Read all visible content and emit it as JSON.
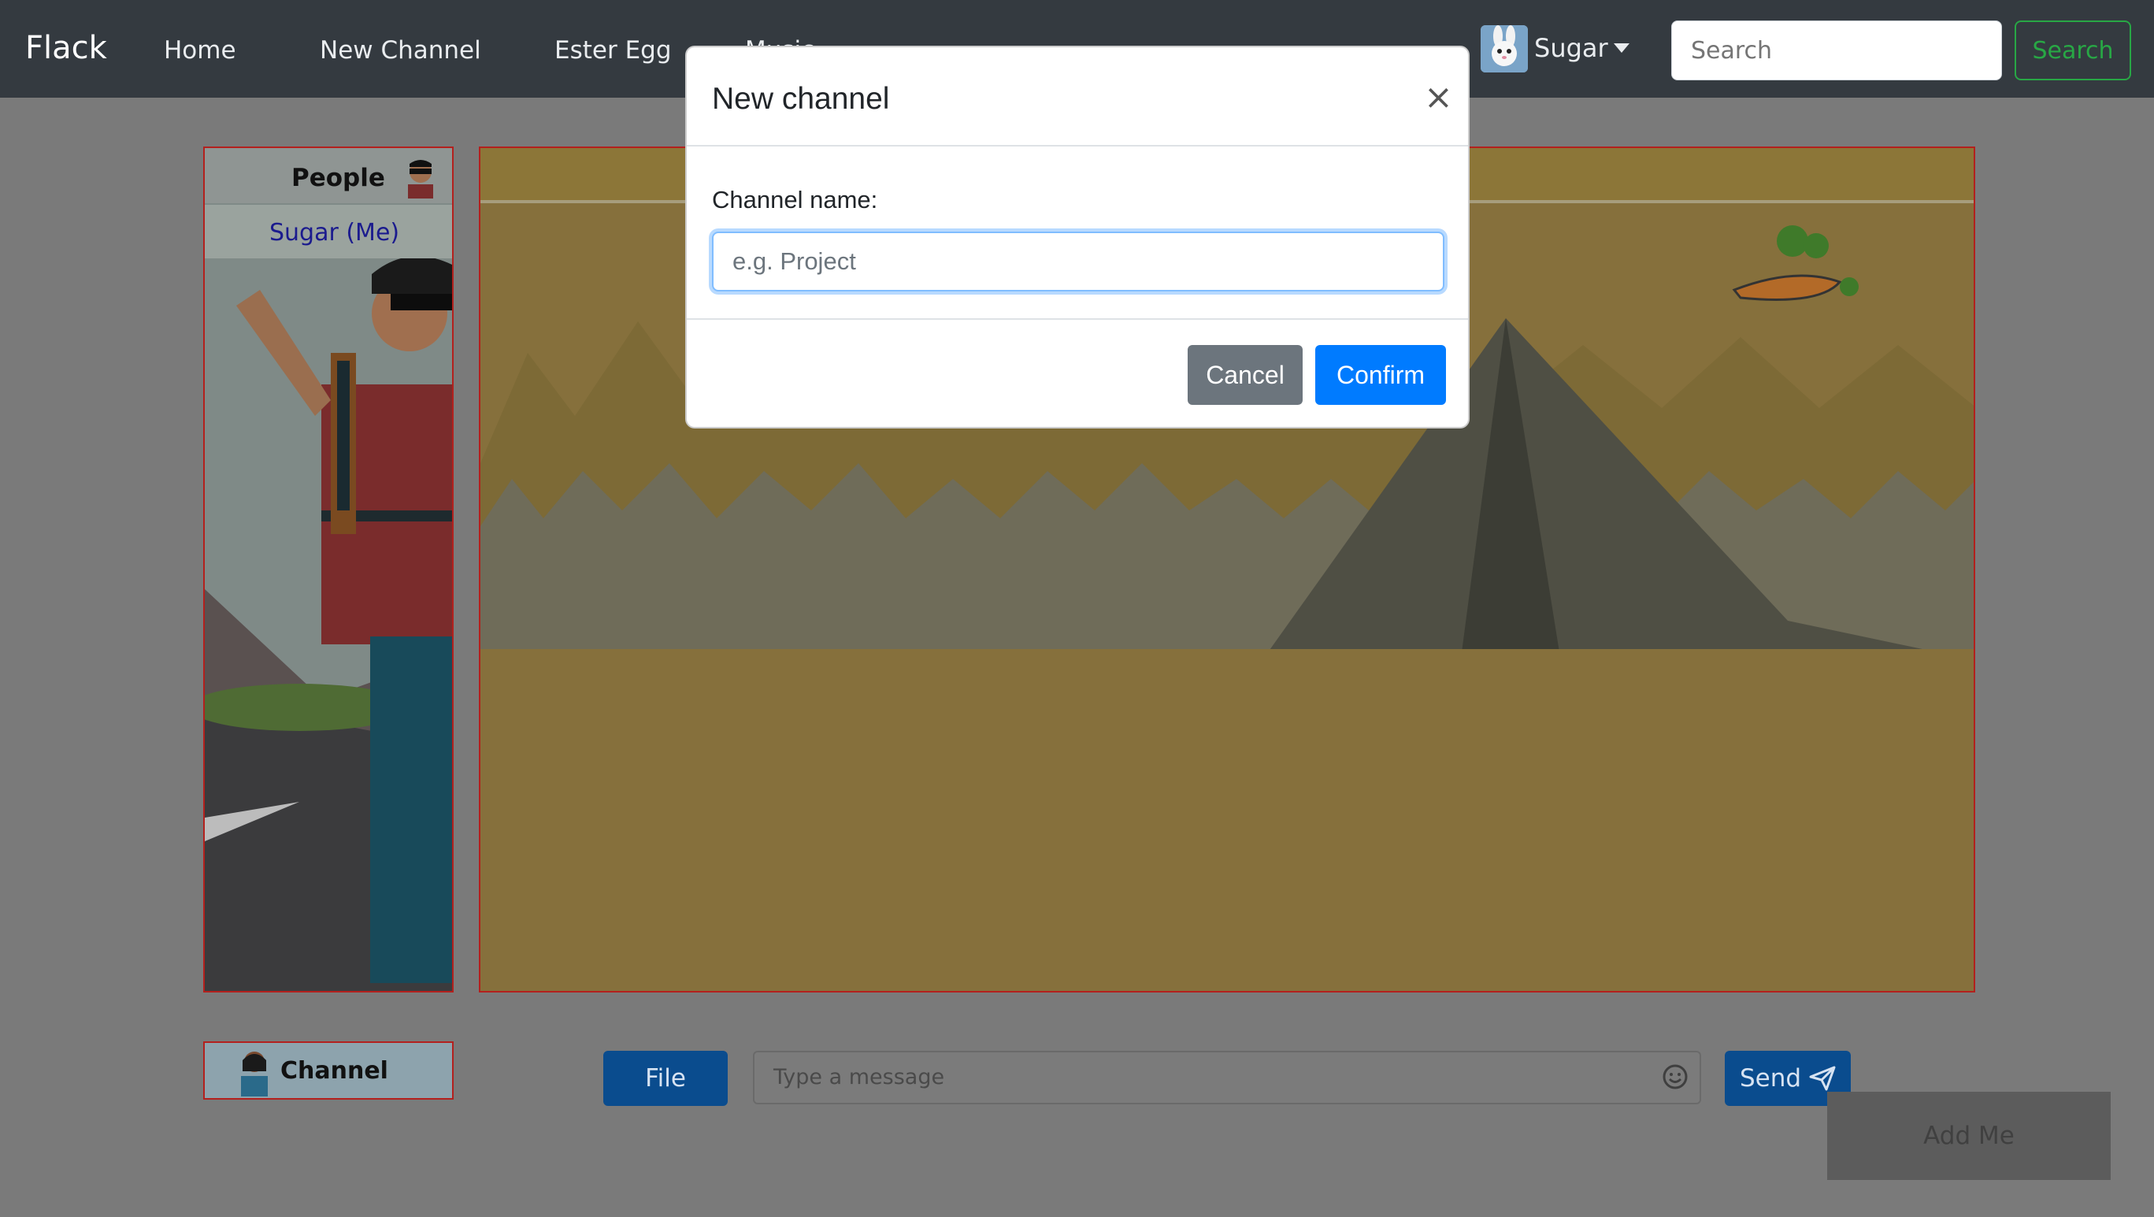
{
  "navbar": {
    "brand": "Flack",
    "links": [
      "Home",
      "New Channel",
      "Ester Egg",
      "Music"
    ],
    "user": {
      "name": "Sugar",
      "avatar_icon": "bunny-avatar-icon"
    },
    "search": {
      "placeholder": "Search",
      "button_label": "Search"
    }
  },
  "sidebar": {
    "people_title": "People",
    "people": [
      "Sugar (Me)"
    ],
    "channel_label": "Channel"
  },
  "composer": {
    "file_label": "File",
    "message_placeholder": "Type a message",
    "send_label": "Send",
    "send_icon": "paper-plane-icon",
    "emoji_icon": "smile-icon"
  },
  "add_me_label": "Add Me",
  "modal": {
    "title": "New channel",
    "close_glyph": "×",
    "field_label": "Channel name:",
    "field_placeholder": "e.g. Project",
    "cancel_label": "Cancel",
    "confirm_label": "Confirm"
  },
  "colors": {
    "navbar": "#343a40",
    "primary": "#007bff",
    "secondary": "#6c757d",
    "success": "#28a745",
    "panel_border": "#b3201d"
  }
}
